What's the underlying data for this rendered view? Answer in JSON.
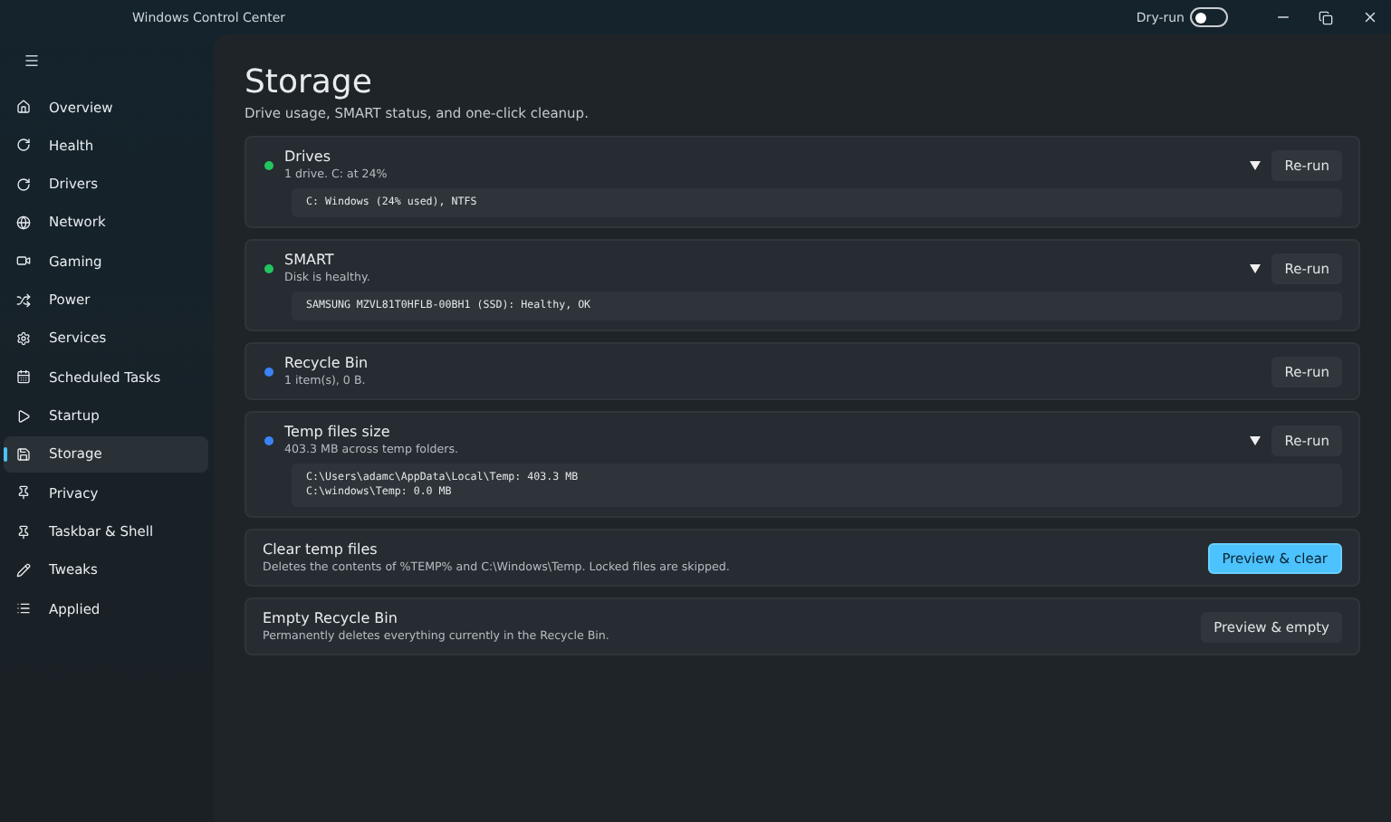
{
  "window": {
    "title": "Windows Control Center",
    "dry_run": {
      "label": "Dry-run",
      "on": false
    }
  },
  "sidebar": {
    "items": [
      {
        "label": "Overview",
        "selected": false
      },
      {
        "label": "Health",
        "selected": false
      },
      {
        "label": "Drivers",
        "selected": false
      },
      {
        "label": "Network",
        "selected": false
      },
      {
        "label": "Gaming",
        "selected": false
      },
      {
        "label": "Power",
        "selected": false
      },
      {
        "label": "Services",
        "selected": false
      },
      {
        "label": "Scheduled Tasks",
        "selected": false
      },
      {
        "label": "Startup",
        "selected": false
      },
      {
        "label": "Storage",
        "selected": true
      },
      {
        "label": "Privacy",
        "selected": false
      },
      {
        "label": "Taskbar & Shell",
        "selected": false
      },
      {
        "label": "Tweaks",
        "selected": false
      },
      {
        "label": "Applied",
        "selected": false
      }
    ]
  },
  "page": {
    "title": "Storage",
    "subtitle": "Drive usage, SMART status, and one-click cleanup."
  },
  "checks": [
    {
      "title": "Drives",
      "summary": "1 drive. C: at 24%",
      "color": "#22c55e",
      "details": [
        "C: Windows (24% used), NTFS"
      ],
      "button": "Re-run"
    },
    {
      "title": "SMART",
      "summary": "Disk is healthy.",
      "color": "#22c55e",
      "details": [
        "SAMSUNG MZVL81T0HFLB-00BH1 (SSD): Healthy, OK"
      ],
      "button": "Re-run"
    },
    {
      "title": "Recycle Bin",
      "summary": "1 item(s), 0 B.",
      "color": "#3b82f6",
      "button": "Re-run"
    },
    {
      "title": "Temp files size",
      "summary": "403.3 MB across temp folders.",
      "color": "#3b82f6",
      "details": [
        "C:\\Users\\adamc\\AppData\\Local\\Temp: 403.3 MB",
        "C:\\windows\\Temp: 0.0 MB"
      ],
      "button": "Re-run"
    }
  ],
  "actions": [
    {
      "title": "Clear temp files",
      "description": "Deletes the contents of %TEMP% and C:\\Windows\\Temp. Locked files are skipped.",
      "button": "Preview & clear",
      "kind": "primary"
    },
    {
      "title": "Empty Recycle Bin",
      "description": "Permanently deletes everything currently in the Recycle Bin.",
      "button": "Preview & empty",
      "kind": "secondary"
    }
  ]
}
